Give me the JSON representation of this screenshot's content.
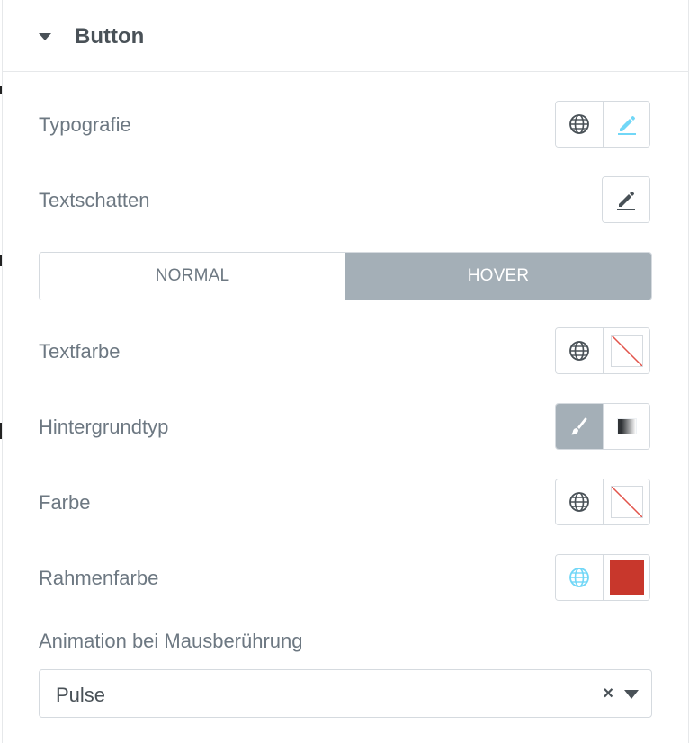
{
  "section": {
    "title": "Button",
    "caret_icon": "caret-down-icon"
  },
  "rows": {
    "typography": {
      "label": "Typografie",
      "icons": [
        "globe-icon",
        "pencil-icon"
      ]
    },
    "text_shadow": {
      "label": "Textschatten",
      "icons": [
        "pencil-icon"
      ]
    },
    "text_color": {
      "label": "Textfarbe",
      "icons": [
        "globe-icon",
        "color-swatch-empty"
      ]
    },
    "background_type": {
      "label": "Hintergrundtyp",
      "icons": [
        "brush-icon",
        "gradient-icon"
      ],
      "selected": "classic"
    },
    "color": {
      "label": "Farbe",
      "icons": [
        "globe-icon",
        "color-swatch-empty"
      ]
    },
    "border_color": {
      "label": "Rahmenfarbe",
      "icons": [
        "globe-icon",
        "color-swatch-filled"
      ],
      "swatch_color": "#c8372c"
    },
    "hover_animation": {
      "label": "Animation bei Mausberührung"
    }
  },
  "tabs": {
    "normal": "NORMAL",
    "hover": "HOVER",
    "active": "hover"
  },
  "select": {
    "value": "Pulse",
    "clear_symbol": "×"
  },
  "colors": {
    "label_text": "#6d7882",
    "heading_text": "#495157",
    "active_tab_bg": "#a4afb7",
    "border": "#d5dadf",
    "accent_blue": "#71d7f7",
    "swatch_red": "#c8372c"
  }
}
